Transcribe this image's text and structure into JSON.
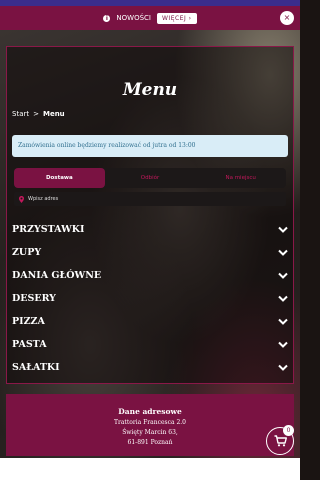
{
  "notice": {
    "label": "NOWOŚCI",
    "more_label": "WIĘCEJ ›",
    "close_label": "×",
    "info_icon": "info-icon"
  },
  "colors": {
    "brand": "#7a1242",
    "alert_bg": "#d9edf7",
    "alert_text": "#31708f"
  },
  "page": {
    "title": "Menu"
  },
  "breadcrumb": {
    "home": "Start",
    "separator": ">",
    "current": "Menu"
  },
  "alert": {
    "text": "Zamówienia online będziemy realizować od jutra od 13:00"
  },
  "tabs": [
    {
      "label": "Dostawa",
      "active": true
    },
    {
      "label": "Odbiór",
      "active": false
    },
    {
      "label": "Na miejscu",
      "active": false
    }
  ],
  "address": {
    "placeholder": "Wpisz adres",
    "icon": "map-pin-icon"
  },
  "categories": [
    {
      "label": "PRZYSTAWKI"
    },
    {
      "label": "ZUPY"
    },
    {
      "label": "DANIA GŁÓWNE"
    },
    {
      "label": "DESERY"
    },
    {
      "label": "PIZZA"
    },
    {
      "label": "PASTA"
    },
    {
      "label": "SAŁATKI"
    }
  ],
  "footer": {
    "title": "Dane adresowe",
    "name": "Trattoria Francesca 2.0",
    "street": "Święty Marcin 63,",
    "city": "61-891 Poznań"
  },
  "cart": {
    "count": "0",
    "icon": "cart-icon"
  }
}
